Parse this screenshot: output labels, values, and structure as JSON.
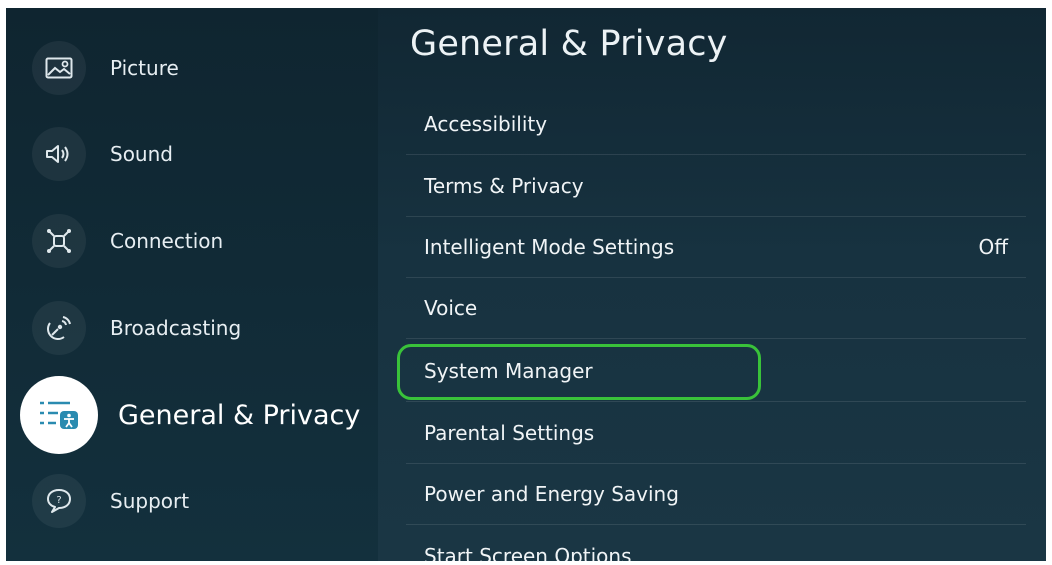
{
  "sidebar": {
    "items": [
      {
        "label": "Picture",
        "icon": "picture-icon"
      },
      {
        "label": "Sound",
        "icon": "sound-icon"
      },
      {
        "label": "Connection",
        "icon": "connection-icon"
      },
      {
        "label": "Broadcasting",
        "icon": "broadcasting-icon"
      },
      {
        "label": "General & Privacy",
        "icon": "general-privacy-icon",
        "active": true
      },
      {
        "label": "Support",
        "icon": "support-icon"
      }
    ]
  },
  "main": {
    "title": "General & Privacy",
    "items": [
      {
        "label": "Accessibility",
        "value": ""
      },
      {
        "label": "Terms & Privacy",
        "value": ""
      },
      {
        "label": "Intelligent Mode Settings",
        "value": "Off"
      },
      {
        "label": "Voice",
        "value": ""
      },
      {
        "label": "System Manager",
        "value": "",
        "focused": true
      },
      {
        "label": "Parental Settings",
        "value": ""
      },
      {
        "label": "Power and Energy Saving",
        "value": ""
      },
      {
        "label": "Start Screen Options",
        "value": ""
      }
    ]
  },
  "colors": {
    "focus_ring": "#39c23a",
    "background": "#173240",
    "active_icon_bg": "#ffffff"
  }
}
